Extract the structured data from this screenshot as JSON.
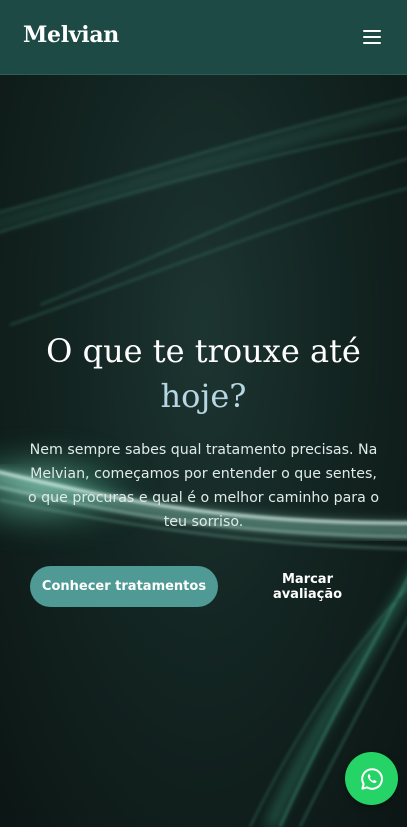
{
  "header": {
    "logo": "Melvian",
    "menu_icon": "hamburger-menu-icon"
  },
  "hero": {
    "title_line1": "O que te trouxe até",
    "title_accent": "hoje?",
    "description": "Nem sempre sabes qual tratamento precisas. Na Melvian, começamos por entender o que sentes, o que procuras e qual é o melhor caminho para o teu sorriso.",
    "primary_button": "Conhecer tratamentos",
    "secondary_button": "Marcar avaliação"
  },
  "floating": {
    "whatsapp_icon": "whatsapp-icon"
  },
  "colors": {
    "header_bg": "#1e4a45",
    "accent_text": "#b7d6e4",
    "primary_button": "#4f9a94",
    "whatsapp": "#25d366"
  }
}
